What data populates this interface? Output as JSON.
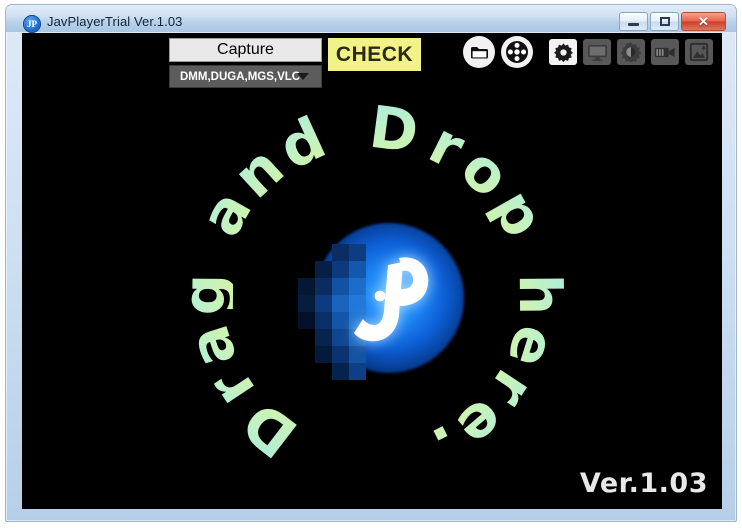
{
  "window": {
    "title": "JavPlayerTrial Ver.1.03",
    "app_icon": "jp-logo-icon",
    "buttons": {
      "minimize": "minimize-icon",
      "maximize": "maximize-icon",
      "close": "✕"
    }
  },
  "toolbar": {
    "capture_label": "Capture",
    "check_label": "CHECK",
    "source_select": {
      "value": "DMM,DUGA,MGS,VLC",
      "caret": "chevron-down-icon"
    },
    "icons": [
      {
        "name": "folder-open-icon",
        "style": "circle",
        "active": false
      },
      {
        "name": "film-reel-icon",
        "style": "circle",
        "active": false
      },
      {
        "name": "gear-icon",
        "style": "square",
        "active": true
      },
      {
        "name": "monitor-icon",
        "style": "square",
        "active": false
      },
      {
        "name": "brightness-icon",
        "style": "square",
        "active": false
      },
      {
        "name": "video-camera-icon",
        "style": "square",
        "active": false
      },
      {
        "name": "image-enhance-icon",
        "style": "square",
        "active": false
      }
    ]
  },
  "canvas": {
    "drop_text": "Drag and Drop here.",
    "logo_text": "JP",
    "version_label": "Ver.1.03"
  },
  "colors": {
    "accent_blue": "#1e86f5",
    "check_yellow": "#f2f288",
    "capture_gray": "#e9e9e9",
    "select_gray": "#5c5c5c",
    "canvas_black": "#000000",
    "drop_text_from": "#a9ecdf",
    "drop_text_to": "#d2f4a4",
    "titlebar_from": "#e2edf8",
    "titlebar_to": "#a9c6e2"
  }
}
